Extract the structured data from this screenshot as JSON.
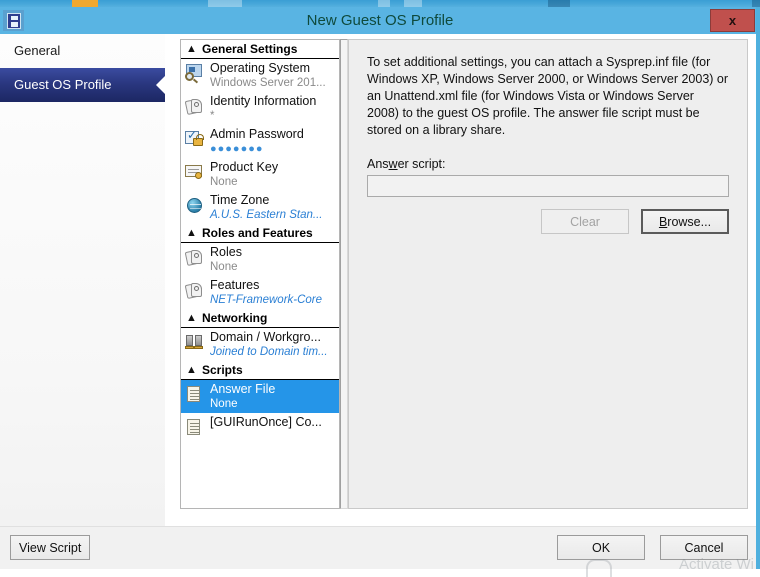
{
  "window": {
    "title": "New Guest OS Profile",
    "icon": "profile-icon",
    "close_label": "x"
  },
  "nav": {
    "items": [
      {
        "label": "General",
        "selected": false
      },
      {
        "label": "Guest OS Profile",
        "selected": true
      }
    ]
  },
  "tree": {
    "sections": [
      {
        "header": "General Settings",
        "chevron": "collapse-up-icon",
        "rows": [
          {
            "title": "Operating System",
            "value": "Windows Server 201...",
            "icon": "operating-system-icon",
            "value_style": "grey",
            "selected": false
          },
          {
            "title": "Identity Information",
            "value": "*",
            "icon": "identity-tags-icon",
            "value_style": "grey",
            "selected": false
          },
          {
            "title": "Admin Password",
            "value": "●●●●●●●",
            "icon": "admin-password-icon",
            "value_style": "dots",
            "selected": false
          },
          {
            "title": "Product Key",
            "value": "None",
            "icon": "product-key-icon",
            "value_style": "grey",
            "selected": false
          },
          {
            "title": "Time Zone",
            "value": "A.U.S. Eastern Stan...",
            "icon": "time-zone-icon",
            "value_style": "blue",
            "selected": false
          }
        ]
      },
      {
        "header": "Roles and Features",
        "chevron": "collapse-up-icon",
        "rows": [
          {
            "title": "Roles",
            "value": "None",
            "icon": "roles-tags-icon",
            "value_style": "grey",
            "selected": false
          },
          {
            "title": "Features",
            "value": "NET-Framework-Core",
            "icon": "features-tags-icon",
            "value_style": "blue",
            "selected": false
          }
        ]
      },
      {
        "header": "Networking",
        "chevron": "collapse-up-icon",
        "rows": [
          {
            "title": "Domain / Workgro...",
            "value": "Joined to Domain tim...",
            "icon": "domain-workgroup-icon",
            "value_style": "blue",
            "selected": false
          }
        ]
      },
      {
        "header": "Scripts",
        "chevron": "collapse-up-icon",
        "rows": [
          {
            "title": "Answer File",
            "value": "None",
            "icon": "answer-file-icon",
            "value_style": "grey",
            "selected": true
          },
          {
            "title": "[GUIRunOnce] Co...",
            "value": "",
            "icon": "guirunonce-icon",
            "value_style": "grey",
            "selected": false
          }
        ]
      }
    ]
  },
  "detail": {
    "intro": "To set additional settings, you can attach a Sysprep.inf file (for Windows XP, Windows Server 2000, or Windows Server 2003) or an Unattend.xml file (for Windows Vista or Windows Server 2008) to the guest OS profile. The answer file script must be stored on a library share.",
    "answer_label_pre": "Ans",
    "answer_label_accel": "w",
    "answer_label_post": "er script:",
    "answer_value": "",
    "answer_placeholder": "",
    "clear_label": "Clear",
    "clear_disabled": true,
    "browse_label_accel": "B",
    "browse_label_post": "rowse..."
  },
  "footer": {
    "view_script_label": "View Script",
    "ok_label": "OK",
    "cancel_label": "Cancel"
  },
  "watermark": {
    "text": "Activate Wi"
  },
  "colors": {
    "titlebar": "#59b4e3",
    "close": "#c0504d",
    "nav_selected": "#2a3780",
    "tree_selected": "#2595e8",
    "value_blue": "#2a7fd4",
    "panel_bg": "#eeeeee"
  }
}
